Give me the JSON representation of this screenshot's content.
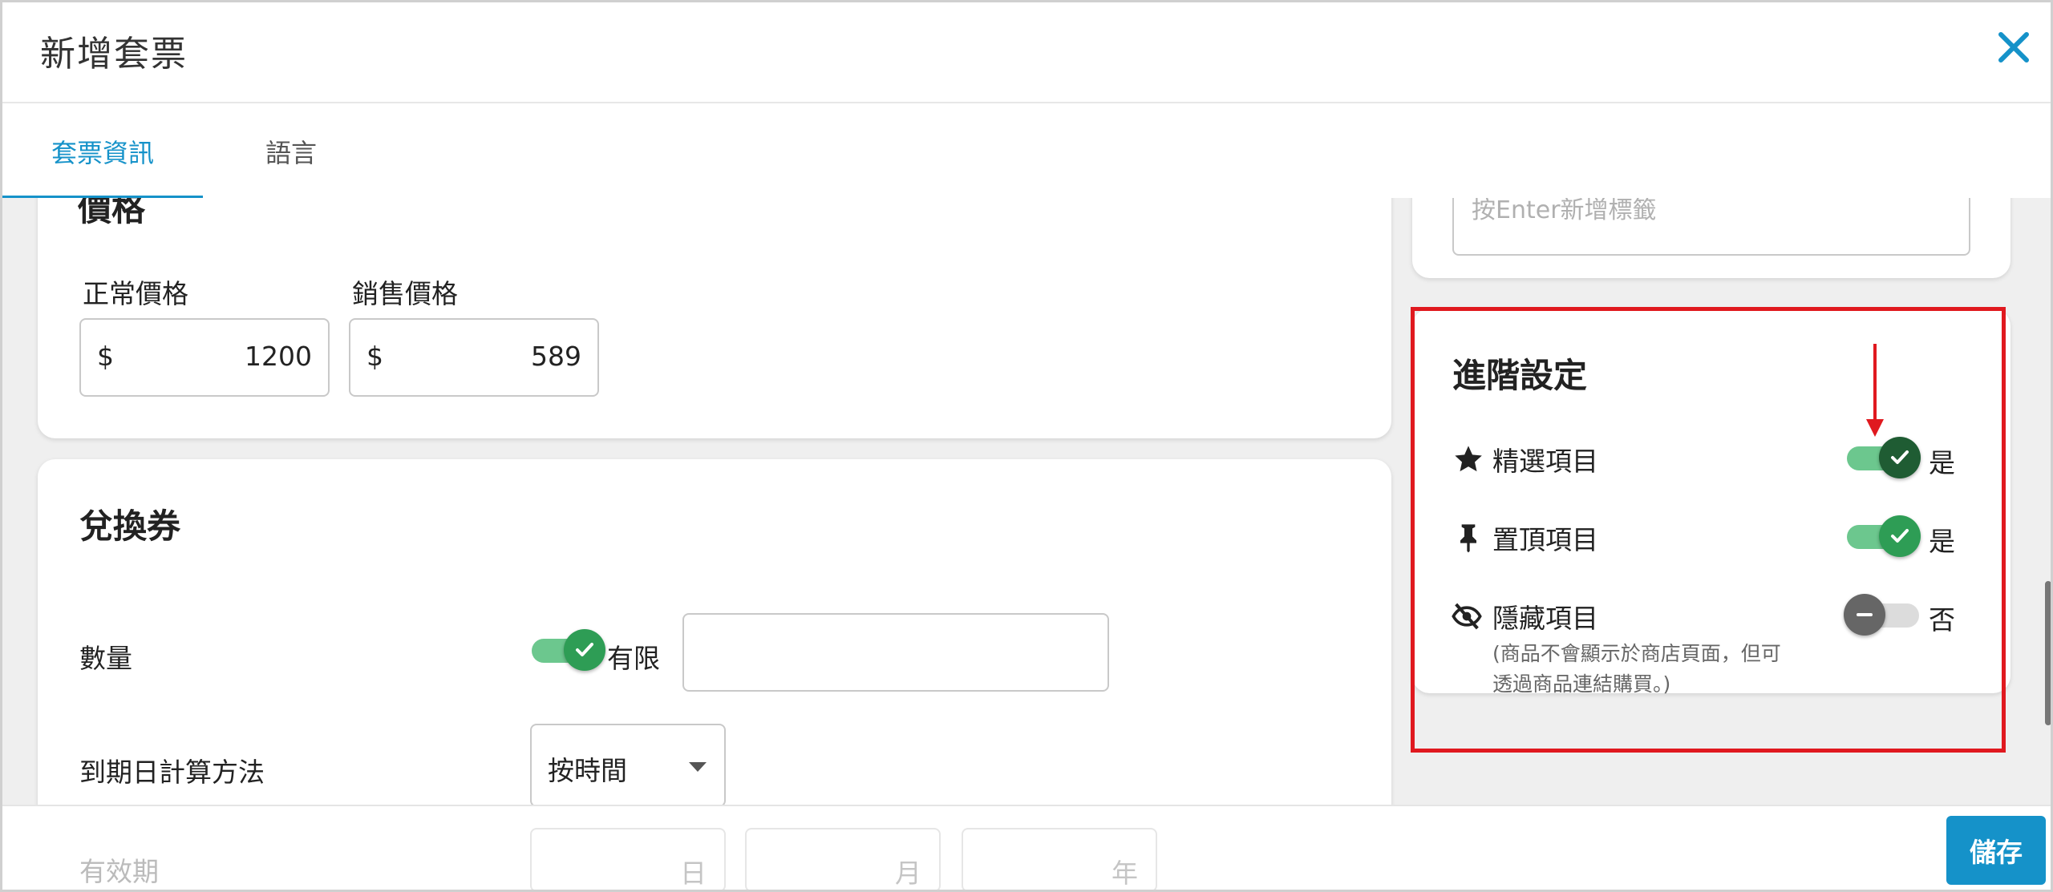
{
  "header": {
    "title": "新增套票"
  },
  "tabs": [
    {
      "label": "套票資訊"
    },
    {
      "label": "語言"
    }
  ],
  "price_card": {
    "heading_partial": "價格",
    "regular_label": "正常價格",
    "sale_label": "銷售價格",
    "currency": "$",
    "regular_value": "1200",
    "sale_value": "589"
  },
  "tag_input": {
    "placeholder": "按Enter新增標籤"
  },
  "voucher_card": {
    "heading": "兌換券",
    "quantity_label": "數量",
    "quantity_toggle_text": "有限",
    "quantity_value": "",
    "expiry_label": "到期日計算方法",
    "expiry_select_value": "按時間",
    "validity_label": "有效期",
    "day_unit": "日",
    "month_unit": "月",
    "year_unit": "年"
  },
  "advanced": {
    "heading": "進階設定",
    "items": [
      {
        "label": "精選項目",
        "icon": "star-icon",
        "state": "是",
        "on": true
      },
      {
        "label": "置頂項目",
        "icon": "pin-icon",
        "state": "是",
        "on": true
      },
      {
        "label": "隱藏項目",
        "icon": "eye-off-icon",
        "state": "否",
        "on": false
      }
    ],
    "hidden_note_line1": "(商品不會顯示於商店頁面，但可",
    "hidden_note_line2": "透過商品連結購買。)"
  },
  "footer": {
    "save_label": "儲存"
  },
  "colors": {
    "accent": "#1592c9",
    "toggle_on": "#6cc78e",
    "highlight": "#e0191f"
  }
}
